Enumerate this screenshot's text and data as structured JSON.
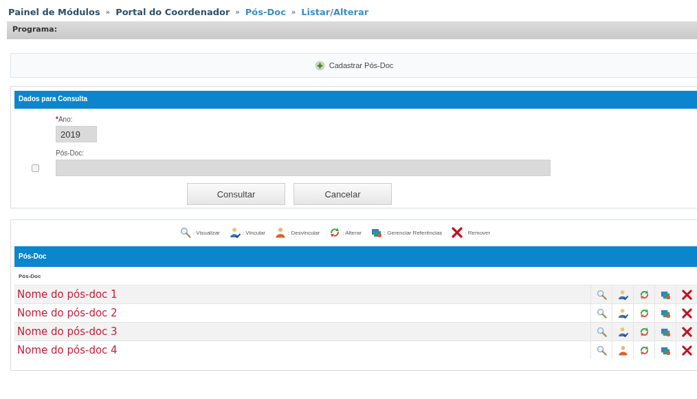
{
  "breadcrumb": [
    {
      "label": "Painel de Módulos"
    },
    {
      "label": "Portal do Coordenador"
    },
    {
      "label": "Pós-Doc"
    },
    {
      "label": "Listar/Alterar"
    }
  ],
  "separator": "»",
  "program_bar": {
    "label": "Programa:"
  },
  "register_button": {
    "label": "Cadastrar Pós-Doc"
  },
  "query_panel": {
    "title": "Dados para Consulta",
    "fields": [
      {
        "required_mark": "*",
        "label": "Ano:",
        "value": "2019"
      },
      {
        "label": "Pós-Doc:",
        "checked": false
      }
    ],
    "buttons": [
      {
        "label": "Consultar"
      },
      {
        "label": "Cancelar"
      }
    ]
  },
  "legend": [
    {
      "kind": "view",
      "label": ": Visualizar"
    },
    {
      "kind": "link",
      "label": ": Vincular"
    },
    {
      "kind": "unlink",
      "label": ": Desvincular"
    },
    {
      "kind": "edit",
      "label": ": Alterar"
    },
    {
      "kind": "refs",
      "label": ": Gerenciar Referências"
    },
    {
      "kind": "remove",
      "label": ": Remover"
    }
  ],
  "table": {
    "title": "Pós-Doc",
    "columns": [
      "Pós-Doc"
    ],
    "rows": [
      {
        "name": "Nome do pós-doc 1",
        "linked": false
      },
      {
        "name": "Nome do pós-doc 2",
        "linked": false
      },
      {
        "name": "Nome do pós-doc 3",
        "linked": false
      },
      {
        "name": "Nome do pós-doc 4",
        "linked": true
      }
    ]
  }
}
